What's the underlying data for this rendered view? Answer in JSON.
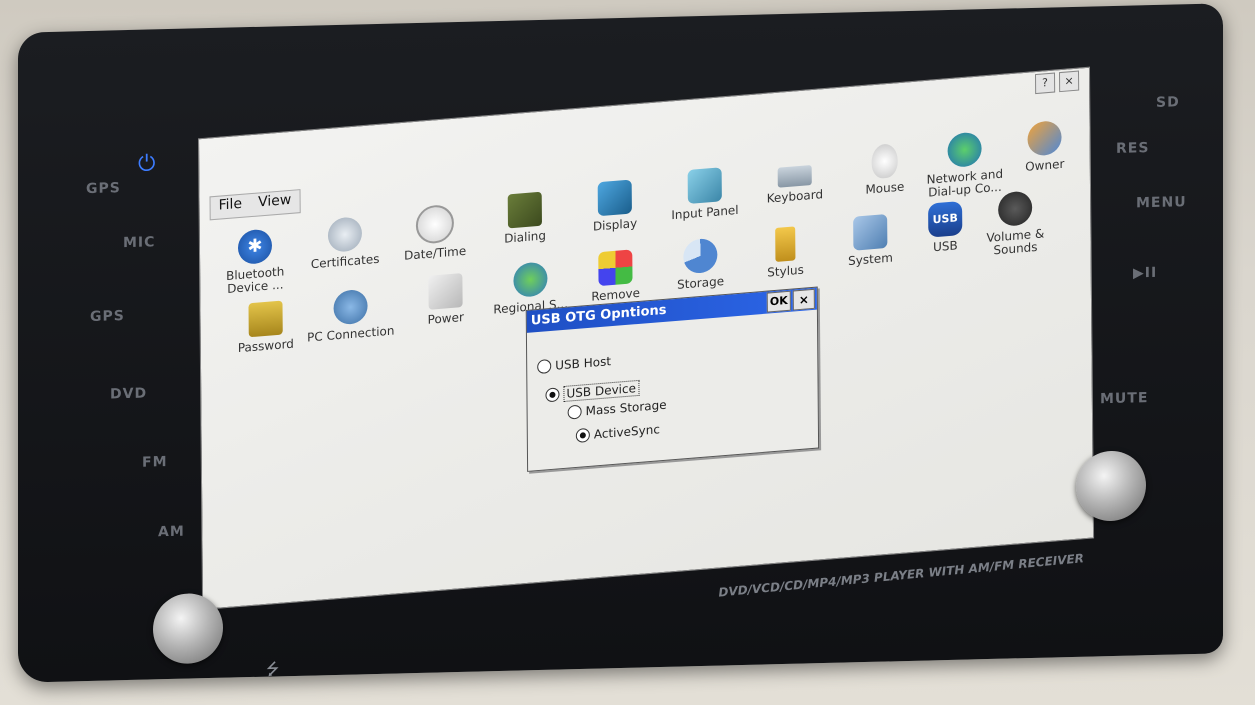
{
  "device": {
    "left_buttons": [
      "GPS",
      "MIC",
      "GPS",
      "DVD",
      "FM",
      "AM"
    ],
    "right_buttons": [
      "SD",
      "RES",
      "MENU",
      "▶II",
      "MUTE"
    ],
    "footer_label": "DVD/VCD/CD/MP4/MP3 PLAYER WITH AM/FM RECEIVER",
    "power_icon": "power-icon",
    "usb_icon": "usb-icon"
  },
  "screen": {
    "menu": [
      "File",
      "View"
    ],
    "title_buttons": [
      "?",
      "×"
    ],
    "icons": [
      {
        "label": "Bluetooth Device ...",
        "icon": "bluetooth-icon"
      },
      {
        "label": "Certificates",
        "icon": "certificates-icon"
      },
      {
        "label": "Date/Time",
        "icon": "clock-icon"
      },
      {
        "label": "Dialing",
        "icon": "phone-icon"
      },
      {
        "label": "Display",
        "icon": "display-icon"
      },
      {
        "label": "Input Panel",
        "icon": "input-panel-icon"
      },
      {
        "label": "Keyboard",
        "icon": "keyboard-icon"
      },
      {
        "label": "Mouse",
        "icon": "mouse-icon"
      },
      {
        "label": "Network and Dial-up Co...",
        "icon": "network-icon"
      },
      {
        "label": "Owner",
        "icon": "owner-icon"
      },
      {
        "label": "Password",
        "icon": "lock-icon"
      },
      {
        "label": "PC Connection",
        "icon": "pc-connection-icon"
      },
      {
        "label": "Power",
        "icon": "power-plug-icon"
      },
      {
        "label": "Regional S...",
        "icon": "globe-icon"
      },
      {
        "label": "Remove",
        "icon": "remove-programs-icon"
      },
      {
        "label": "Storage",
        "icon": "storage-pie-icon"
      },
      {
        "label": "Stylus",
        "icon": "stylus-icon"
      },
      {
        "label": "System",
        "icon": "system-icon"
      },
      {
        "label": "USB",
        "icon": "usb-icon"
      },
      {
        "label": "Volume & Sounds",
        "icon": "speaker-icon"
      }
    ]
  },
  "dialog": {
    "title": "USB OTG Opntions",
    "ok_label": "OK",
    "close_label": "×",
    "options": [
      {
        "label": "USB Host",
        "selected": false
      },
      {
        "label": "USB Device",
        "selected": true
      },
      {
        "label": "Mass Storage",
        "selected": false
      },
      {
        "label": "ActiveSync",
        "selected": true
      }
    ]
  }
}
